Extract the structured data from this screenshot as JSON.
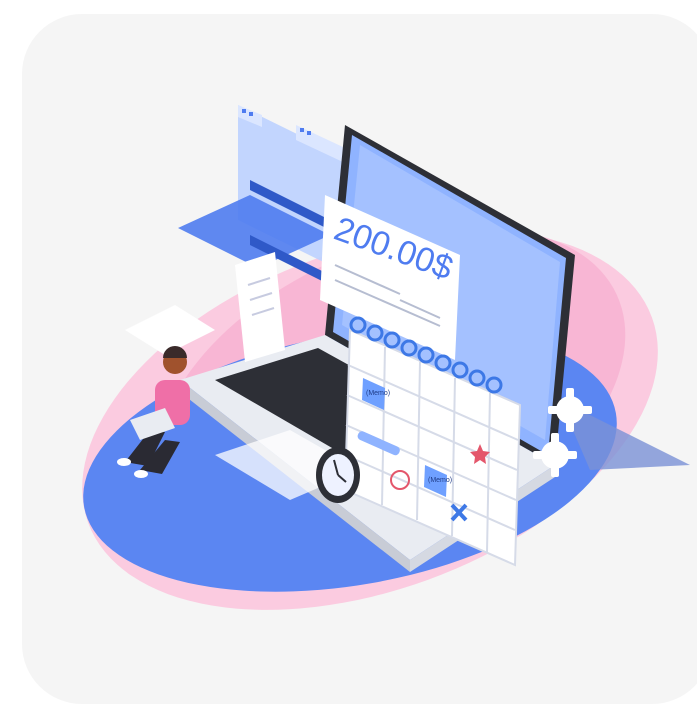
{
  "invoice": {
    "amount": "200.00$"
  },
  "calendar": {
    "notes": [
      "(Memo)",
      "(Memo)"
    ]
  },
  "colors": {
    "background_card": "#f5f5f5",
    "platform_blue": "#4f7cf0",
    "platform_pink": "#f7a8cc",
    "screen_blue": "#8fb3ff",
    "laptop_body": "#e9ecf2",
    "keyboard": "#2d2f36",
    "person_shirt": "#ef6fa7",
    "person_pants": "#2a2a33",
    "accent_blue": "#3d78e6",
    "red_mark": "#e4566b"
  },
  "icons": [
    "gear-icon",
    "gear-icon",
    "clock-icon",
    "receipt-icon",
    "calendar-icon",
    "star-icon",
    "cross-icon",
    "circle-icon"
  ]
}
